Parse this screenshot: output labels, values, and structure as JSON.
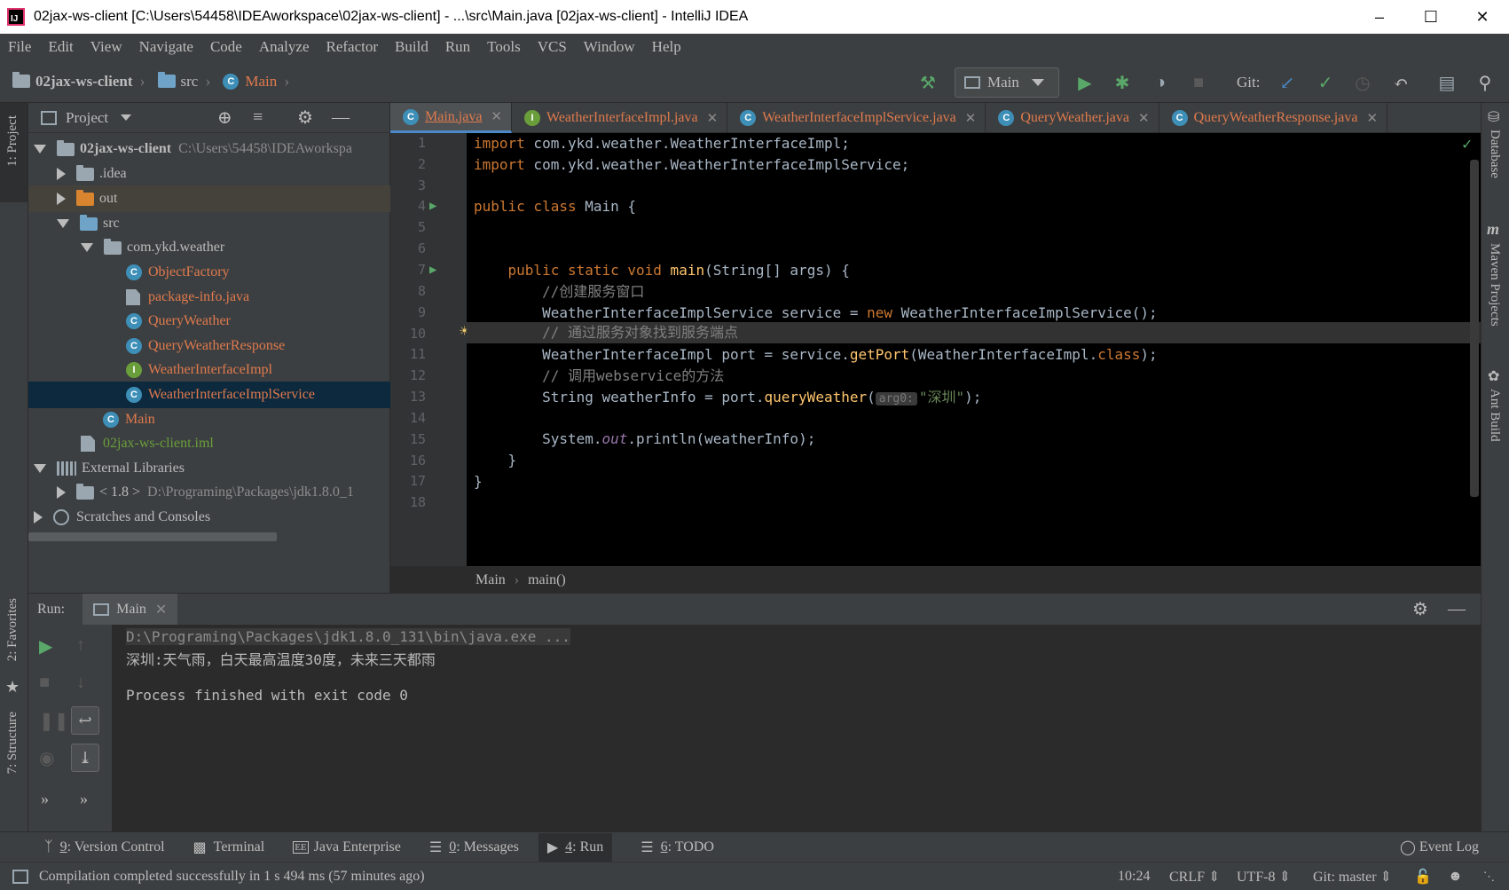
{
  "window": {
    "title": "02jax-ws-client [C:\\Users\\54458\\IDEAworkspace\\02jax-ws-client] - ...\\src\\Main.java [02jax-ws-client] - IntelliJ IDEA",
    "app_badge": "IJ"
  },
  "menu": [
    "File",
    "Edit",
    "View",
    "Navigate",
    "Code",
    "Analyze",
    "Refactor",
    "Build",
    "Run",
    "Tools",
    "VCS",
    "Window",
    "Help"
  ],
  "breadcrumb": {
    "project": "02jax-ws-client",
    "folder": "src",
    "file": "Main"
  },
  "toolbar": {
    "run_config": "Main",
    "git_label": "Git:"
  },
  "left_strip": {
    "project": "1: Project",
    "favorites": "2: Favorites",
    "structure": "7: Structure"
  },
  "right_strip": {
    "database": "Database",
    "maven": "Maven Projects",
    "ant": "Ant Build"
  },
  "project_panel": {
    "title": "Project",
    "tree": [
      {
        "label": "02jax-ws-client",
        "path": "C:\\Users\\54458\\IDEAworkspa"
      },
      {
        "label": ".idea"
      },
      {
        "label": "out"
      },
      {
        "label": "src"
      },
      {
        "label": "com.ykd.weather"
      },
      {
        "label": "ObjectFactory",
        "badge": "C"
      },
      {
        "label": "package-info.java"
      },
      {
        "label": "QueryWeather",
        "badge": "C"
      },
      {
        "label": "QueryWeatherResponse",
        "badge": "C"
      },
      {
        "label": "WeatherInterfaceImpl",
        "badge": "I"
      },
      {
        "label": "WeatherInterfaceImplService",
        "badge": "C"
      },
      {
        "label": "Main",
        "badge": "C"
      },
      {
        "label": "02jax-ws-client.iml"
      },
      {
        "label": "External Libraries"
      },
      {
        "label": "< 1.8 >",
        "path": "D:\\Programing\\Packages\\jdk1.8.0_1"
      },
      {
        "label": "Scratches and Consoles"
      }
    ]
  },
  "tabs": [
    {
      "label": "Main.java",
      "badge": "C"
    },
    {
      "label": "WeatherInterfaceImpl.java",
      "badge": "I"
    },
    {
      "label": "WeatherInterfaceImplService.java",
      "badge": "C"
    },
    {
      "label": "QueryWeather.java",
      "badge": "C"
    },
    {
      "label": "QueryWeatherResponse.java",
      "badge": "C"
    }
  ],
  "line_numbers": [
    "1",
    "2",
    "3",
    "4",
    "5",
    "6",
    "7",
    "8",
    "9",
    "10",
    "11",
    "12",
    "13",
    "14",
    "15",
    "16",
    "17",
    "18"
  ],
  "code": {
    "l1_kw": "import",
    "l1_rest": " com.ykd.weather.WeatherInterfaceImpl;",
    "l2_kw": "import",
    "l2_rest": " com.ykd.weather.WeatherInterfaceImplService;",
    "l4_kw": "public class",
    "l4_rest": " Main {",
    "l7_kw": "    public static void",
    "l7_fn": " main",
    "l7_rest": "(String[] args) {",
    "l8": "        //创建服务窗口",
    "l9_a": "        WeatherInterfaceImplService service = ",
    "l9_kw": "new",
    "l9_b": " WeatherInterfaceImplService();",
    "l10": "        // 通过服务对象找到服务端点",
    "l11_a": "        WeatherInterfaceImpl port = service.",
    "l11_fn": "getPort",
    "l11_b": "(WeatherInterfaceImpl.",
    "l11_kw": "class",
    "l11_c": ");",
    "l12": "        // 调用webservice的方法",
    "l13_a": "        String weatherInfo = port.",
    "l13_fn": "queryWeather",
    "l13_b": "(",
    "l13_hint": "arg0:",
    "l13_str": "\"深圳\"",
    "l13_c": ");",
    "l15_a": "        System.",
    "l15_st": "out",
    "l15_b": ".println(weatherInfo);",
    "l16": "    }",
    "l17": "}"
  },
  "editor_breadcrumb": {
    "class": "Main",
    "method": "main()"
  },
  "run_panel": {
    "label": "Run:",
    "tab": "Main",
    "output": [
      "D:\\Programing\\Packages\\jdk1.8.0_131\\bin\\java.exe ...",
      "深圳:天气雨，白天最高温度30度，未来三天都雨",
      "",
      "Process finished with exit code 0"
    ]
  },
  "tool_windows": [
    {
      "key": "9",
      "label": ": Version Control"
    },
    {
      "key": "",
      "label": "Terminal"
    },
    {
      "key": "",
      "label": "Java Enterprise"
    },
    {
      "key": "0",
      "label": ": Messages"
    },
    {
      "key": "4",
      "label": ": Run"
    },
    {
      "key": "6",
      "label": ": TODO"
    }
  ],
  "event_log": "Event Log",
  "status": {
    "message": "Compilation completed successfully in 1 s 494 ms (57 minutes ago)",
    "position": "10:24",
    "line_sep": "CRLF",
    "encoding": "UTF-8",
    "git": "Git: master"
  },
  "colors": {
    "accent": "#4a88c7",
    "run_green": "#59a869",
    "file_orange": "#e07a4d",
    "selection": "#0d293e"
  }
}
